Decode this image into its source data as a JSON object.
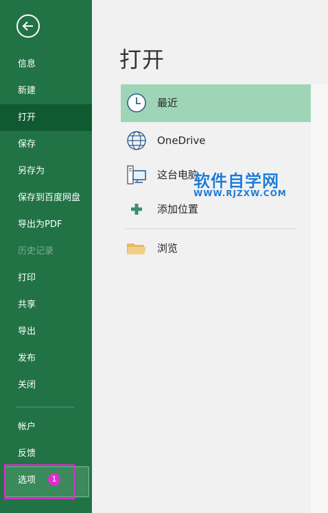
{
  "sidebar": {
    "back_label": "",
    "items": [
      {
        "label": "信息"
      },
      {
        "label": "新建"
      },
      {
        "label": "打开"
      },
      {
        "label": "保存"
      },
      {
        "label": "另存为"
      },
      {
        "label": "保存到百度网盘"
      },
      {
        "label": "导出为PDF"
      },
      {
        "label": "历史记录"
      },
      {
        "label": "打印"
      },
      {
        "label": "共享"
      },
      {
        "label": "导出"
      },
      {
        "label": "发布"
      },
      {
        "label": "关闭"
      }
    ],
    "bottom_items": [
      {
        "label": "帐户"
      },
      {
        "label": "反馈"
      }
    ],
    "options_label": "选项",
    "options_badge": "1"
  },
  "main": {
    "title": "打开",
    "locations": [
      {
        "label": "最近"
      },
      {
        "label": "OneDrive"
      },
      {
        "label": "这台电脑"
      },
      {
        "label": "添加位置"
      },
      {
        "label": "浏览"
      }
    ]
  },
  "watermark": {
    "title": "软件自学网",
    "url": "WWW.RJZXW.COM"
  },
  "colors": {
    "sidebar": "#217346",
    "sidebar_active": "#0f5a31",
    "location_active": "#9fd5b7",
    "highlight": "#e12bd2"
  }
}
